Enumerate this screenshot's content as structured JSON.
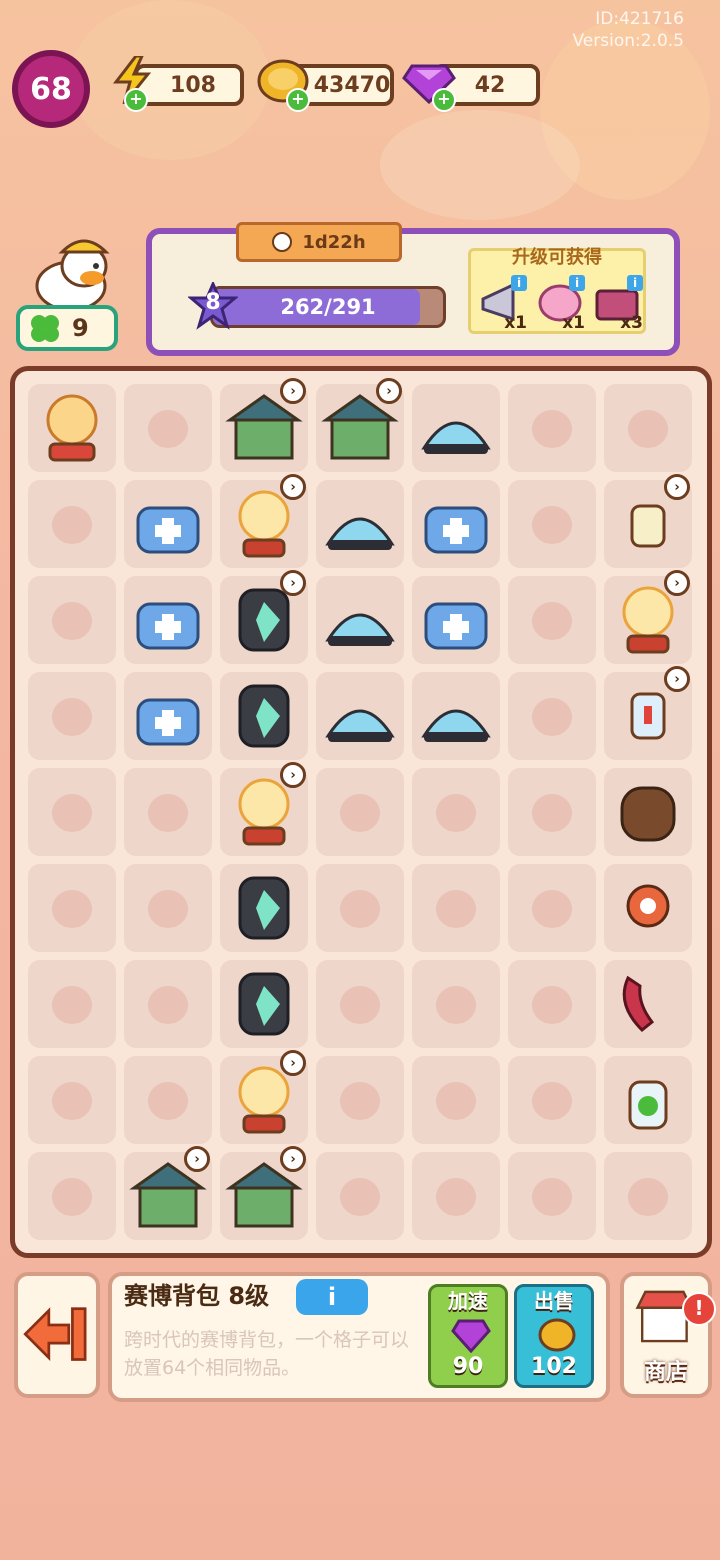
{
  "meta": {
    "id_text": "ID:421716",
    "version_text": "Version:2.0.5"
  },
  "player": {
    "level": "68"
  },
  "resources": {
    "energy": {
      "value": "108",
      "icon": "lightning-icon",
      "color": "#f5c51e"
    },
    "coins": {
      "value": "43470",
      "icon": "coin-icon",
      "color": "#f0b429"
    },
    "gems": {
      "value": "42",
      "icon": "gem-icon",
      "color": "#b343d8"
    }
  },
  "clover": {
    "value": "9",
    "icon": "clover-icon"
  },
  "event": {
    "timer": "1d22h",
    "level": "8",
    "progress_text": "262/291",
    "progress_current": 262,
    "progress_max": 291,
    "rewards_title": "升级可获得",
    "rewards": [
      {
        "icon": "megaphone-icon",
        "count": "x1"
      },
      {
        "icon": "brain-icon",
        "count": "x1"
      },
      {
        "icon": "ticket-box-icon",
        "count": "x3"
      }
    ]
  },
  "board": {
    "items": [
      {
        "icon": "plasma-ball-generator-icon"
      },
      {
        "icon": "townhouse-icon"
      },
      {
        "icon": "townhouse-icon"
      },
      {
        "icon": "tent-icon"
      },
      {
        "icon": "first-aid-kit-icon"
      },
      {
        "icon": "plasma-ball-icon"
      },
      {
        "icon": "tent-icon"
      },
      {
        "icon": "first-aid-kit-icon"
      },
      {
        "icon": "lantern-icon"
      },
      {
        "icon": "first-aid-kit-icon"
      },
      {
        "icon": "cyber-backpack-icon"
      },
      {
        "icon": "tent-icon"
      },
      {
        "icon": "first-aid-kit-icon"
      },
      {
        "icon": "plasma-ball-icon"
      },
      {
        "icon": "first-aid-kit-icon"
      },
      {
        "icon": "cyber-backpack-icon"
      },
      {
        "icon": "tent-icon"
      },
      {
        "icon": "tent-icon"
      },
      {
        "icon": "iv-bag-icon"
      },
      {
        "icon": "plasma-ball-icon"
      },
      {
        "icon": "air-fryer-icon"
      },
      {
        "icon": "cyber-backpack-icon"
      },
      {
        "icon": "tape-measure-icon"
      },
      {
        "icon": "cyber-backpack-icon"
      },
      {
        "icon": "telephone-receiver-icon"
      },
      {
        "icon": "plasma-ball-icon"
      },
      {
        "icon": "bottled-clover-icon"
      },
      {
        "icon": "townhouse-icon"
      },
      {
        "icon": "townhouse-icon"
      }
    ]
  },
  "selected_item": {
    "name": "赛博背包 8级",
    "info_label": "i",
    "description": "跨时代的赛博背包，一个格子可以放置64个相同物品。"
  },
  "actions": {
    "speed_label": "加速",
    "speed_cost": "90",
    "sell_label": "出售",
    "sell_price": "102",
    "shop_label": "商店",
    "shop_alert": "!"
  },
  "colors": {
    "board_border": "#7a3c28",
    "event_border": "#8e4fb8",
    "accent_green": "#8fcf4b",
    "accent_blue": "#37bfd7"
  }
}
